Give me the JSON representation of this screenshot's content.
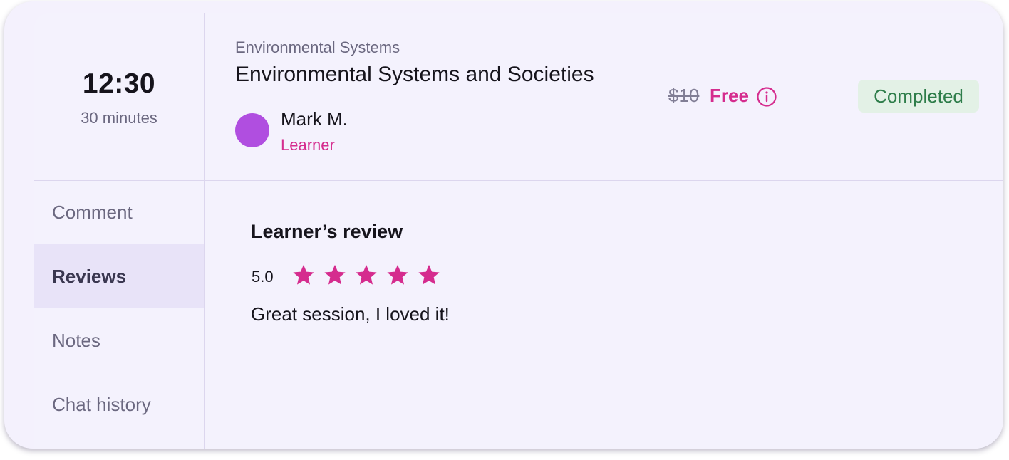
{
  "session": {
    "time": "12:30",
    "duration": "30 minutes",
    "subject": "Environmental Systems",
    "title": "Environmental Systems and Societies",
    "person": {
      "name": "Mark M.",
      "role": "Learner",
      "avatar_color": "#b04ee0"
    },
    "price": {
      "original": "$10",
      "current": "Free"
    },
    "status": "Completed"
  },
  "sidebar": {
    "items": [
      {
        "label": "Comment",
        "active": false
      },
      {
        "label": "Reviews",
        "active": true
      },
      {
        "label": "Notes",
        "active": false
      },
      {
        "label": "Chat history",
        "active": false
      }
    ]
  },
  "review": {
    "heading": "Learner’s review",
    "rating": "5.0",
    "stars_filled": 5,
    "stars_total": 5,
    "text": "Great session, I loved it!"
  },
  "colors": {
    "accent": "#d52c8e",
    "status_bg": "#e3f1e6",
    "status_text": "#2e7d4a",
    "card_bg": "#f4f1fd"
  },
  "icons": {
    "info": "info-circle-icon",
    "star": "star-icon"
  }
}
